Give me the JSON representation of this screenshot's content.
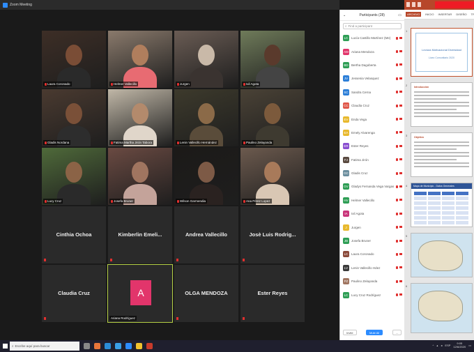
{
  "zoom": {
    "window_title": "Zoom Meeting",
    "tiles": [
      {
        "name": "Laura Coronado",
        "scene": "#3d2e26",
        "skin": "#7a4d36",
        "shirt": "#2a2a2a"
      },
      {
        "name": "Helmer Vallecillo",
        "scene": "#8a7a6c",
        "skin": "#b07e5d",
        "shirt": "#e86b72"
      },
      {
        "name": "Jurgen",
        "scene": "#6a5c54",
        "skin": "#c9b9a8",
        "shirt": "#3a3330"
      },
      {
        "name": "Ixil Agota",
        "scene": "#6f7b5a",
        "skin": "#5a3a2c",
        "shirt": "#444"
      },
      {
        "name": "Gladis Nordana",
        "scene": "#4a3a30",
        "skin": "#7a5038",
        "shirt": "#2d2d2d"
      },
      {
        "name": "Fatima Martha Jirón Tabora",
        "scene": "#c0b7a7",
        "skin": "#b38a6c",
        "shirt": "#e0d6ca"
      },
      {
        "name": "Lenin Vallecillo Hernández",
        "scene": "#3d3a2c",
        "skin": "#8b6a48",
        "shirt": "#5a4c3a"
      },
      {
        "name": "Paulino Zelayanda",
        "scene": "#4a4236",
        "skin": "#7c5a3c",
        "shirt": "#3e3a30"
      },
      {
        "name": "Lucy Cruz",
        "scene": "#4f6a3a",
        "skin": "#8b6346",
        "shirt": "#2a2a2a"
      },
      {
        "name": "Josefa Bruner",
        "scene": "#6a4a42",
        "skin": "#a07560",
        "shirt": "#c4a39a"
      },
      {
        "name": "Wilson Garmendia",
        "scene": "#1c1a18",
        "skin": "#7d5a46",
        "shirt": "#2a2220"
      },
      {
        "name": "Ana Pérez Lopez",
        "scene": "#6c5a4e",
        "skin": "#a87a5a",
        "shirt": "#d9c7b4"
      },
      {
        "name": "Cinthia Ochoa"
      },
      {
        "name": "Kimberlin Emeli..."
      },
      {
        "name": "Andrea Vallecillo"
      },
      {
        "name": "Josè Luis Rodrig..."
      },
      {
        "name": "Claudia Cruz"
      },
      {
        "name": "A",
        "caption": "Ariana Rodríguez"
      },
      {
        "name": "OLGA MENDOZA"
      },
      {
        "name": "Ester Reyes"
      }
    ]
  },
  "participants": {
    "header": "Participants (28)",
    "search_placeholder": "Find a participant",
    "items": [
      {
        "name": "Lucía Castillo Martínez (Me)",
        "initials": "LC",
        "color": "#2e9e55"
      },
      {
        "name": "Ariana Mendoza",
        "initials": "AM",
        "color": "#e2356b"
      },
      {
        "name": "Bertha Dagoberta",
        "initials": "BD",
        "color": "#2e9e55"
      },
      {
        "name": "Jessenia Velasquez",
        "initials": "JV",
        "color": "#2d7fd8"
      },
      {
        "name": "Sandra Cerna",
        "initials": "SC",
        "color": "#2d7fd8"
      },
      {
        "name": "Claudia Cruz",
        "initials": "CC",
        "color": "#e0584a"
      },
      {
        "name": "Enda Vega",
        "initials": "EV",
        "color": "#e8b92e"
      },
      {
        "name": "Emely Alvarenga",
        "initials": "EA",
        "color": "#e8b92e"
      },
      {
        "name": "Ester Reyes",
        "initials": "ER",
        "color": "#8a4fd0"
      },
      {
        "name": "Fatima Jirón",
        "initials": "FJ",
        "color": "#5a4a40"
      },
      {
        "name": "Gladis Cruz",
        "initials": "GC",
        "color": "#6b8e9e"
      },
      {
        "name": "Gladys Fernanda Vega Vargas",
        "initials": "GV",
        "color": "#2e9e55"
      },
      {
        "name": "Helmer Vallecillo",
        "initials": "HV",
        "color": "#2e9e55"
      },
      {
        "name": "Ixil Agota",
        "initials": "IA",
        "color": "#c9357a"
      },
      {
        "name": "Jurgen",
        "initials": "J",
        "color": "#e8b92e"
      },
      {
        "name": "Josefa Bruner",
        "initials": "JB",
        "color": "#2e9e55"
      },
      {
        "name": "Laura Coronado",
        "initials": "LC",
        "color": "#8b4a3a"
      },
      {
        "name": "Lenin Vallecillo Hdez",
        "initials": "LV",
        "color": "#3a3a3a"
      },
      {
        "name": "Paulino Zelayanda",
        "initials": "PZ",
        "color": "#a07560"
      },
      {
        "name": "Lucy Cruz Rodríguez",
        "initials": "LC",
        "color": "#2e9e55"
      }
    ],
    "footer_invite": "Invite",
    "footer_mute_all": "Mute All",
    "footer_more": "..."
  },
  "ppt": {
    "tabs": [
      "ARCHIVO",
      "INICIO",
      "INSERTAR",
      "DISEÑO",
      "TRA"
    ],
    "slides": [
      {
        "num": "1",
        "heading": "Lectura Motivacional Diversidad",
        "subtitle": "Liceo Comunitario 2020"
      },
      {
        "num": "2",
        "heading": "Introducción"
      },
      {
        "num": "3",
        "heading": "Objetivo"
      },
      {
        "num": "4",
        "heading": "Mapa de Municipio - Datos Generales"
      },
      {
        "num": "5"
      },
      {
        "num": "6"
      }
    ]
  },
  "taskbar": {
    "search_placeholder": "Escribe aquí para buscar",
    "time": "9:05",
    "date": "12/6/2020",
    "lang": "ESP"
  }
}
